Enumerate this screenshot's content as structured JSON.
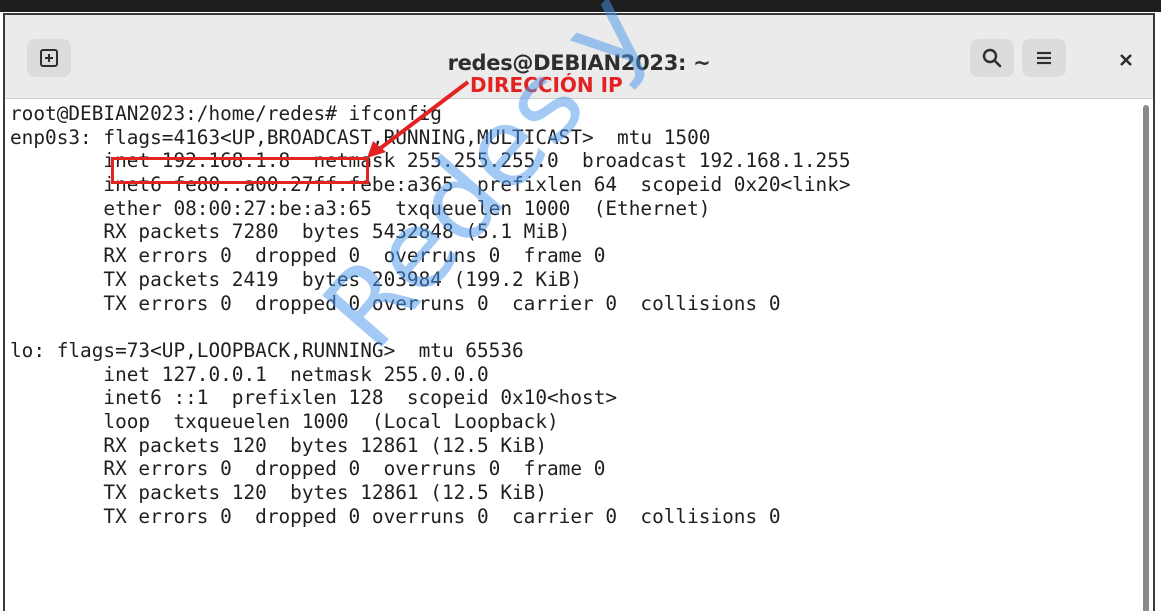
{
  "window": {
    "title": "redes@DEBIAN2023: ~",
    "icons": [
      "new-tab-icon",
      "search-icon",
      "hamburger-menu-icon",
      "close-icon"
    ]
  },
  "terminal": {
    "lines": [
      "root@DEBIAN2023:/home/redes# ifconfig",
      "enp0s3: flags=4163<UP,BROADCAST,RUNNING,MULTICAST>  mtu 1500",
      "        inet 192.168.1.8  netmask 255.255.255.0  broadcast 192.168.1.255",
      "        inet6 fe80::a00:27ff:febe:a365  prefixlen 64  scopeid 0x20<link>",
      "        ether 08:00:27:be:a3:65  txqueuelen 1000  (Ethernet)",
      "        RX packets 7280  bytes 5432848 (5.1 MiB)",
      "        RX errors 0  dropped 0  overruns 0  frame 0",
      "        TX packets 2419  bytes 203984 (199.2 KiB)",
      "        TX errors 0  dropped 0 overruns 0  carrier 0  collisions 0",
      "",
      "lo: flags=73<UP,LOOPBACK,RUNNING>  mtu 65536",
      "        inet 127.0.0.1  netmask 255.0.0.0",
      "        inet6 ::1  prefixlen 128  scopeid 0x10<host>",
      "        loop  txqueuelen 1000  (Local Loopback)",
      "        RX packets 120  bytes 12861 (12.5 KiB)",
      "        RX errors 0  dropped 0  overruns 0  frame 0",
      "        TX packets 120  bytes 12861 (12.5 KiB)",
      "        TX errors 0  dropped 0 overruns 0  carrier 0  collisions 0"
    ]
  },
  "annotation": {
    "label": "DIRECCIÓN IP",
    "color": "#e32222"
  },
  "watermark": {
    "text": "Redes y Seguridad",
    "color": "#4696eb"
  }
}
